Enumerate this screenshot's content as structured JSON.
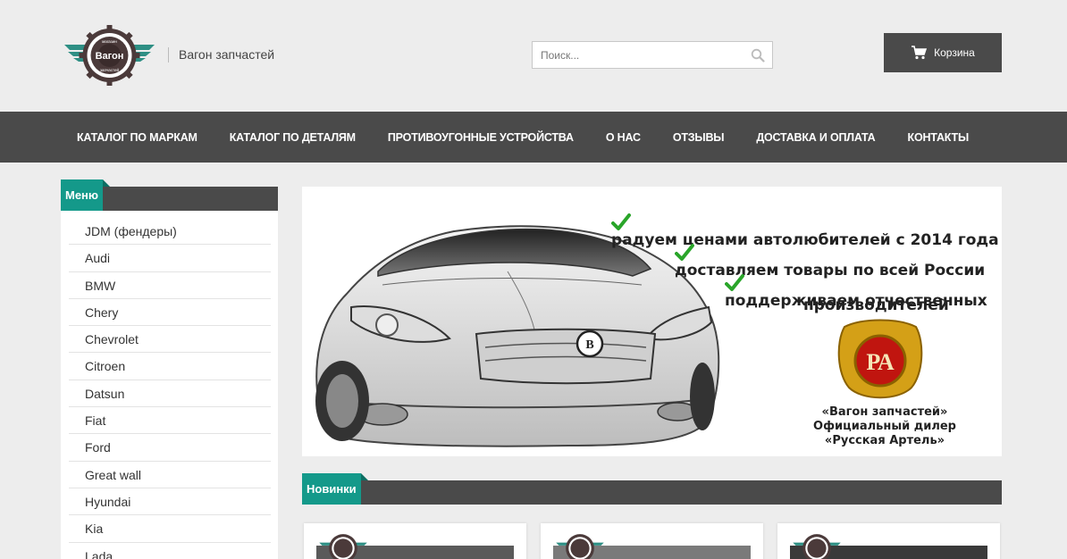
{
  "header": {
    "logo": {
      "ring_text_top": "магазин",
      "center_text": "Вагон",
      "ring_text_bottom": "запчастей"
    },
    "site_name": "Вагон запчастей",
    "search": {
      "placeholder": "Поиск...",
      "value": "",
      "icon": "search-icon"
    },
    "cart": {
      "label": "Корзина",
      "icon": "cart-icon"
    }
  },
  "nav": {
    "items": [
      {
        "label": "КАТАЛОГ ПО МАРКАМ"
      },
      {
        "label": "КАТАЛОГ ПО ДЕТАЛЯМ"
      },
      {
        "label": "ПРОТИВОУГОННЫЕ УСТРОЙСТВА"
      },
      {
        "label": "О НАС"
      },
      {
        "label": "ОТЗЫВЫ"
      },
      {
        "label": "ДОСТАВКА И ОПЛАТА"
      },
      {
        "label": "КОНТАКТЫ"
      }
    ]
  },
  "sidebar": {
    "title": "Меню",
    "items": [
      {
        "label": "JDM (фендеры)"
      },
      {
        "label": "Audi"
      },
      {
        "label": "BMW"
      },
      {
        "label": "Chery"
      },
      {
        "label": "Chevrolet"
      },
      {
        "label": "Citroen"
      },
      {
        "label": "Datsun"
      },
      {
        "label": "Fiat"
      },
      {
        "label": "Ford"
      },
      {
        "label": "Great wall"
      },
      {
        "label": "Hyundai"
      },
      {
        "label": "Kia"
      },
      {
        "label": "Lada"
      }
    ]
  },
  "banner": {
    "lines": [
      "радуем ценами автолюбителей с 2014 года",
      "доставляем товары по всей России",
      "поддерживаем отчественных",
      "производителей"
    ],
    "emblem_text": "РА",
    "dealer": [
      "«Вагон запчастей»",
      "Официальный дилер",
      "«Русская Артель»"
    ],
    "car_badge": "B"
  },
  "new_products": {
    "title": "Новинки",
    "cards": [
      {},
      {},
      {}
    ]
  },
  "colors": {
    "accent": "#14998a",
    "dark_bar": "#4a4a4a",
    "background": "#ededed",
    "check_green": "#2aa52a"
  }
}
